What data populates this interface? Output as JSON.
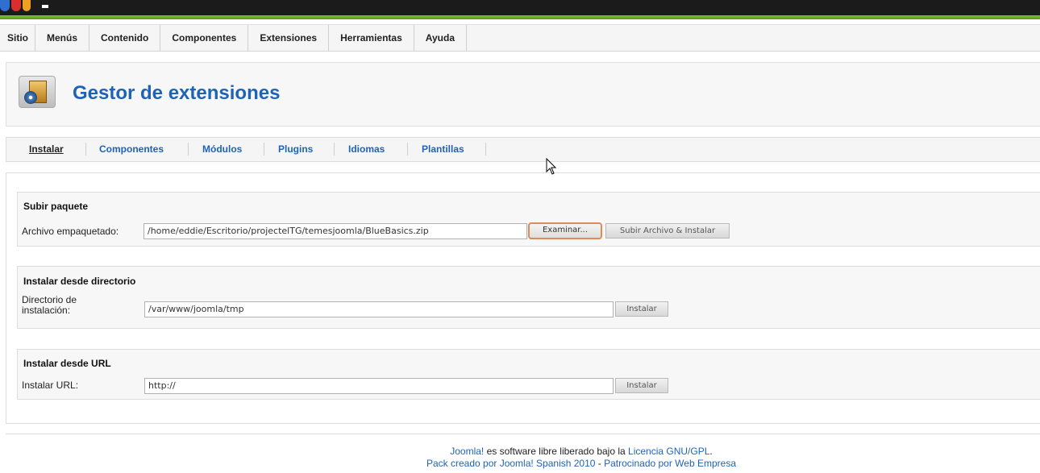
{
  "menu": {
    "items": [
      {
        "id": "sitio",
        "label": "Sitio"
      },
      {
        "id": "menus",
        "label": "Menús"
      },
      {
        "id": "contenido",
        "label": "Contenido"
      },
      {
        "id": "componentes",
        "label": "Componentes"
      },
      {
        "id": "extensiones",
        "label": "Extensiones"
      },
      {
        "id": "herramientas",
        "label": "Herramientas"
      },
      {
        "id": "ayuda",
        "label": "Ayuda"
      }
    ]
  },
  "header": {
    "title": "Gestor de extensiones",
    "icon": "extension-manager-icon"
  },
  "tabs": [
    {
      "label": "Instalar",
      "active": true
    },
    {
      "label": "Componentes",
      "active": false
    },
    {
      "label": "Módulos",
      "active": false
    },
    {
      "label": "Plugins",
      "active": false
    },
    {
      "label": "Idiomas",
      "active": false
    },
    {
      "label": "Plantillas",
      "active": false
    }
  ],
  "upload": {
    "legend": "Subir paquete",
    "label": "Archivo empaquetado:",
    "value": "/home/eddie/Escritorio/projectelTG/temesjoomla/BlueBasics.zip",
    "browse_label": "Examinar...",
    "submit_label": "Subir Archivo & Instalar"
  },
  "directory": {
    "legend": "Instalar desde directorio",
    "label": "Directorio de instalación:",
    "value": "/var/www/joomla/tmp",
    "submit_label": "Instalar"
  },
  "url": {
    "legend": "Instalar desde URL",
    "label": "Instalar URL:",
    "value": "http://",
    "submit_label": "Instalar"
  },
  "footer": {
    "line1_link1": "Joomla!",
    "line1_text": " es software libre liberado bajo la ",
    "line1_link2": "Licencia GNU/GPL",
    "line1_end": ".",
    "line2_link1": "Pack creado por Joomla! Spanish 2010",
    "line2_sep": " - ",
    "line2_link2": "Patrocinado por Web Empresa"
  },
  "colors": {
    "accent": "#1f63b6",
    "green_strip": "#6aab2a",
    "focus_border": "#e08a58"
  }
}
